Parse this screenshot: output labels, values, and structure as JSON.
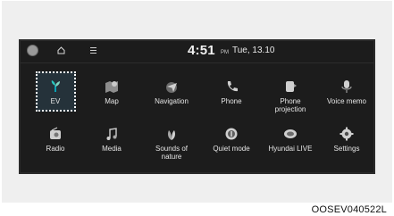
{
  "status": {
    "time": "4:51",
    "ampm": "PM",
    "date": "Tue, 13.10"
  },
  "apps": [
    {
      "label": "EV",
      "icon": "ev-icon"
    },
    {
      "label": "Map",
      "icon": "map-icon"
    },
    {
      "label": "Navigation",
      "icon": "navigation-icon"
    },
    {
      "label": "Phone",
      "icon": "phone-icon"
    },
    {
      "label": "Phone\nprojection",
      "icon": "phone-projection-icon"
    },
    {
      "label": "Voice memo",
      "icon": "voice-memo-icon"
    },
    {
      "label": "Radio",
      "icon": "radio-icon"
    },
    {
      "label": "Media",
      "icon": "media-icon"
    },
    {
      "label": "Sounds of\nnature",
      "icon": "sounds-of-nature-icon"
    },
    {
      "label": "Quiet mode",
      "icon": "quiet-mode-icon"
    },
    {
      "label": "Hyundai LIVE",
      "icon": "hyundai-live-icon"
    },
    {
      "label": "Settings",
      "icon": "settings-icon"
    }
  ],
  "caption": "OOSEV040522L"
}
